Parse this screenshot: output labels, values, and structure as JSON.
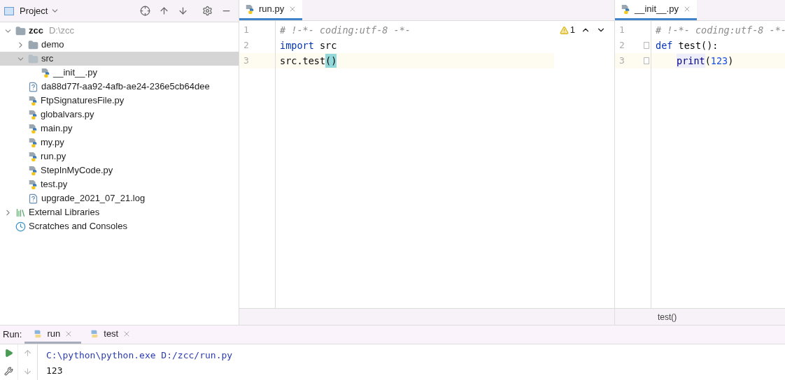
{
  "project_panel": {
    "title": "Project",
    "tree": [
      {
        "name": "zcc",
        "path": "D:\\zcc",
        "kind": "folder",
        "expanded": true,
        "selected": false,
        "children": [
          {
            "name": "demo",
            "kind": "folder",
            "expanded": false,
            "selected": false
          },
          {
            "name": "src",
            "kind": "package",
            "expanded": true,
            "selected": true,
            "children": [
              {
                "name": "__init__.py",
                "kind": "python",
                "selected": false
              }
            ]
          },
          {
            "name": "da88d77f-aa92-4afb-ae24-236e5cb64dee",
            "kind": "unknown",
            "selected": false
          },
          {
            "name": "FtpSignaturesFile.py",
            "kind": "python",
            "selected": false
          },
          {
            "name": "globalvars.py",
            "kind": "python",
            "selected": false
          },
          {
            "name": "main.py",
            "kind": "python",
            "selected": false
          },
          {
            "name": "my.py",
            "kind": "python",
            "selected": false
          },
          {
            "name": "run.py",
            "kind": "python",
            "selected": false
          },
          {
            "name": "StepInMyCode.py",
            "kind": "python",
            "selected": false
          },
          {
            "name": "test.py",
            "kind": "python",
            "selected": false
          },
          {
            "name": "upgrade_2021_07_21.log",
            "kind": "unknown",
            "selected": false
          }
        ]
      },
      {
        "name": "External Libraries",
        "kind": "libraries",
        "expanded": false,
        "selected": false
      },
      {
        "name": "Scratches and Consoles",
        "kind": "scratches",
        "selected": false
      }
    ]
  },
  "editors": [
    {
      "tab": "run.py",
      "warnings": "1",
      "lines": [
        {
          "number": "1",
          "current": false,
          "tokens": [
            {
              "kind": "comment",
              "text": "# !-*- coding:utf-8 -*-"
            }
          ]
        },
        {
          "number": "2",
          "current": false,
          "tokens": [
            {
              "kind": "keyword",
              "text": "import"
            },
            {
              "kind": "plain",
              "text": " src"
            }
          ]
        },
        {
          "number": "3",
          "current": true,
          "tokens": [
            {
              "kind": "plain",
              "text": "src.test"
            },
            {
              "kind": "match",
              "text": "()"
            }
          ]
        }
      ]
    },
    {
      "tab": "__init__.py",
      "breadcrumb": "test()",
      "lines": [
        {
          "number": "1",
          "current": false,
          "tokens": [
            {
              "kind": "comment",
              "text": "# !-*- coding:utf-8 -*-"
            }
          ]
        },
        {
          "number": "2",
          "current": false,
          "fold": true,
          "tokens": [
            {
              "kind": "keyword",
              "text": "def"
            },
            {
              "kind": "plain",
              "text": " test():"
            }
          ]
        },
        {
          "number": "3",
          "current": true,
          "fold": true,
          "indented": true,
          "tokens": [
            {
              "kind": "builtin",
              "text": "print"
            },
            {
              "kind": "plain",
              "text": "("
            },
            {
              "kind": "number",
              "text": "123"
            },
            {
              "kind": "plain",
              "text": ")"
            }
          ]
        }
      ]
    }
  ],
  "run_panel": {
    "label": "Run:",
    "tabs": [
      {
        "label": "run",
        "selected": true
      },
      {
        "label": "test",
        "selected": false
      }
    ],
    "output": [
      {
        "kind": "command",
        "text": "C:\\python\\python.exe D:/zcc/run.py"
      },
      {
        "kind": "stdout",
        "text": "123"
      }
    ]
  }
}
